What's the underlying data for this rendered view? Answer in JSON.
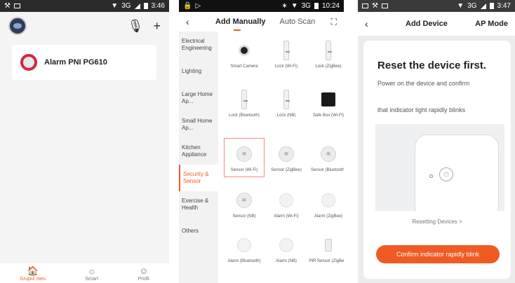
{
  "phone1": {
    "status_time": "3:46",
    "status_net": "3G",
    "device_name": "Alarm PNI PG610",
    "tabs": [
      {
        "label": "Grupul meu",
        "icon": "home-icon"
      },
      {
        "label": "Smart",
        "icon": "sun-icon"
      },
      {
        "label": "Profil",
        "icon": "profile-icon"
      }
    ]
  },
  "phone2": {
    "status_time": "10:24",
    "status_net": "3G",
    "tab_manual": "Add Manually",
    "tab_scan": "Auto Scan",
    "categories": [
      "Electrical Engineering",
      "Lighting",
      "Large Home Ap...",
      "Small Home Ap...",
      "Kitchen Appliance",
      "Security & Sensor",
      "Exercise & Health",
      "Others"
    ],
    "devices": [
      "Smart Camera",
      "Lock (Wi-Fi)",
      "Lock (ZigBee)",
      "Lock (Bluetooth)",
      "Lock (NB)",
      "Safe Box (Wi-Fi)",
      "Sensor (Wi-Fi)",
      "Sensor (ZigBee)",
      "Sensor (Bluetooth)",
      "Sensor (NB)",
      "Alarm (Wi-Fi)",
      "Alarm (ZigBee)",
      "Alarm (Bluetooth)",
      "Alarm (NB)",
      "PIR Sensor (ZigBee)"
    ]
  },
  "phone3": {
    "status_time": "3:47",
    "status_net": "3G",
    "title": "Add Device",
    "mode": "AP Mode",
    "heading": "Reset the device first.",
    "line1": "Power on the device and confirm",
    "line2": "that indicator light rapidly blinks",
    "link": "Resetting Devices >",
    "cta": "Confirm indicator rapidly blink"
  },
  "colors": {
    "accent": "#f05b24"
  }
}
